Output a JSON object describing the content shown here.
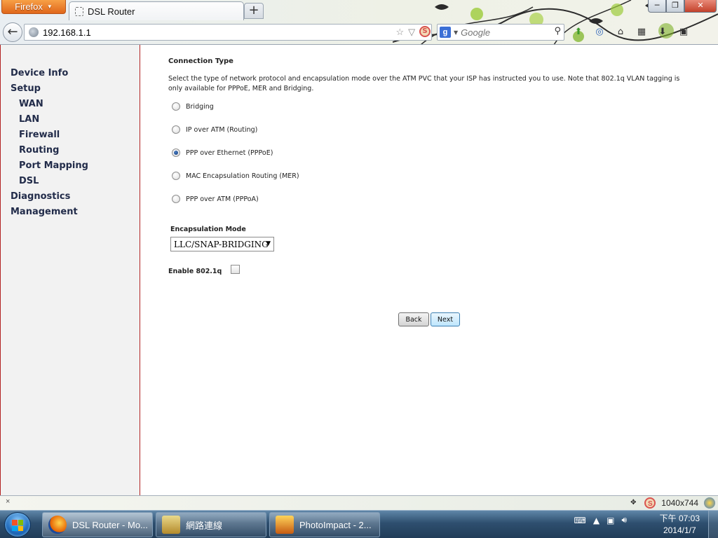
{
  "browser": {
    "menu_button": "Firefox",
    "tab_title": "DSL Router",
    "new_tab_glyph": "+",
    "url": "192.168.1.1",
    "search_placeholder": "Google",
    "search_engine_icon": "g-icon",
    "window_controls": {
      "minimize": "─",
      "maximize": "❐",
      "close": "✕"
    }
  },
  "sidebar": {
    "items": [
      {
        "label": "Device Info",
        "level": 0
      },
      {
        "label": "Setup",
        "level": 0
      },
      {
        "label": "WAN",
        "level": 1
      },
      {
        "label": "LAN",
        "level": 1
      },
      {
        "label": "Firewall",
        "level": 1
      },
      {
        "label": "Routing",
        "level": 1
      },
      {
        "label": "Port Mapping",
        "level": 1
      },
      {
        "label": "DSL",
        "level": 1
      },
      {
        "label": "Diagnostics",
        "level": 0
      },
      {
        "label": "Management",
        "level": 0
      }
    ]
  },
  "form": {
    "title": "Connection Type",
    "description": "Select the type of network protocol and encapsulation mode over the ATM PVC that your ISP has instructed you to use. Note that 802.1q VLAN tagging is only available for PPPoE, MER and Bridging.",
    "options": [
      {
        "label": "Bridging",
        "checked": false
      },
      {
        "label": "IP over ATM (Routing)",
        "checked": false
      },
      {
        "label": "PPP over Ethernet (PPPoE)",
        "checked": true
      },
      {
        "label": "MAC Encapsulation Routing (MER)",
        "checked": false
      },
      {
        "label": "PPP over ATM (PPPoA)",
        "checked": false
      }
    ],
    "encapsulation_label": "Encapsulation Mode",
    "encapsulation_value": "LLC/SNAP-BRIDGING",
    "vlan_label": "Enable 802.1q",
    "vlan_checked": false,
    "back_label": "Back",
    "next_label": "Next"
  },
  "addon_bar": {
    "close_glyph": "×",
    "resolution": "1040x744"
  },
  "taskbar": {
    "tasks": [
      {
        "label": "DSL Router - Mo...",
        "icon": "firefox-icon",
        "active": true
      },
      {
        "label": "網路連線",
        "icon": "network-connections-icon",
        "active": false
      },
      {
        "label": "PhotoImpact - 2...",
        "icon": "photoimpact-icon",
        "active": false
      }
    ],
    "clock_time": "下午 07:03",
    "clock_date": "2014/1/7"
  },
  "colors": {
    "sidebar_border": "#b22222",
    "menu_text": "#222c4a",
    "taskbar": "#2e4f6f"
  }
}
